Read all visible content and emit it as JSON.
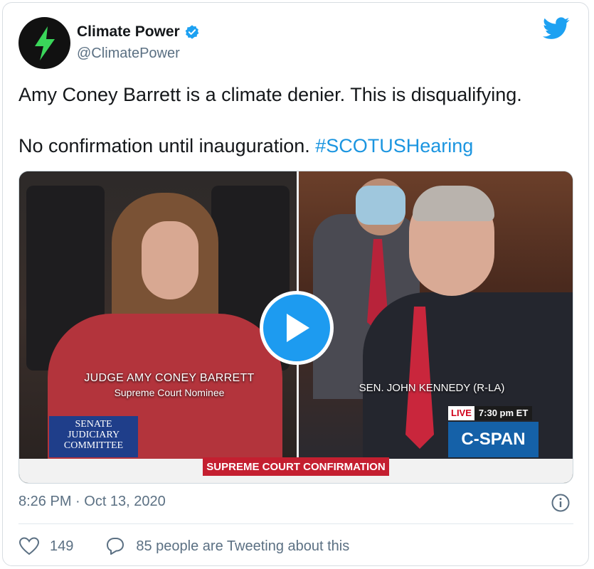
{
  "account": {
    "display_name": "Climate Power",
    "handle": "@ClimatePower",
    "avatar_icon": "lightning-bolt-icon",
    "brand_color": "#1da1f2",
    "avatar_bolt_color": "#3ad65a"
  },
  "tweet": {
    "line1": "Amy Coney Barrett is a climate denier. This is disqualifying.",
    "line2_text": "No confirmation until inauguration. ",
    "hashtag": "#SCOTUSHearing"
  },
  "video": {
    "caption_left_name": "JUDGE AMY CONEY BARRETT",
    "caption_left_role": "Supreme Court Nominee",
    "caption_right": "SEN. JOHN KENNEDY (R-LA)",
    "committee_line1": "SENATE",
    "committee_line2": "JUDICIARY",
    "committee_line3": "COMMITTEE",
    "live_label": "LIVE",
    "live_time": "7:30 pm ET",
    "network": "C-SPAN",
    "banner": "SUPREME COURT CONFIRMATION",
    "play_icon": "play-icon"
  },
  "meta": {
    "timestamp": "8:26 PM · Oct 13, 2020",
    "info_icon": "info-icon"
  },
  "actions": {
    "likes": "149",
    "conversation": "85 people are Tweeting about this"
  }
}
